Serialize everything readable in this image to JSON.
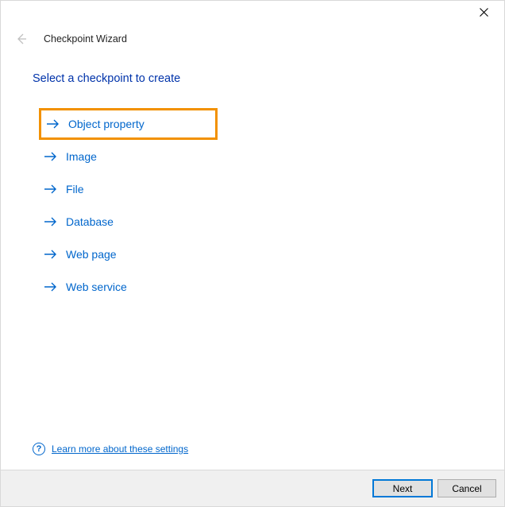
{
  "window": {
    "title": "Checkpoint Wizard"
  },
  "page": {
    "heading": "Select a checkpoint to create"
  },
  "options": {
    "object_property": "Object property",
    "image": "Image",
    "file": "File",
    "database": "Database",
    "web_page": "Web page",
    "web_service": "Web service"
  },
  "help": {
    "link_text": "Learn more about these settings"
  },
  "buttons": {
    "next": "Next",
    "cancel": "Cancel"
  },
  "colors": {
    "link": "#0066cc",
    "heading": "#0033aa",
    "highlight_border": "#f29100",
    "primary_button_border": "#0078d7"
  }
}
